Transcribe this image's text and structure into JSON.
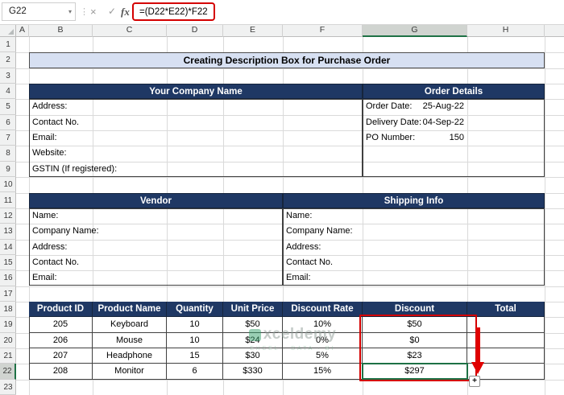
{
  "formula_bar": {
    "name_box": "G22",
    "formula": "=(D22*E22)*F22",
    "fx_label": "fx"
  },
  "icons": {
    "cancel": "×",
    "enter": "✓",
    "name_box_chevron": "▾",
    "splitter": "⋮",
    "fill_handle": "+"
  },
  "grid": {
    "column_headers": [
      "A",
      "B",
      "C",
      "D",
      "E",
      "F",
      "G",
      "H"
    ],
    "selected_column": "G",
    "row_headers": [
      "1",
      "2",
      "3",
      "4",
      "5",
      "6",
      "7",
      "8",
      "9",
      "10",
      "11",
      "12",
      "13",
      "14",
      "15",
      "16",
      "17",
      "18",
      "19",
      "20",
      "21",
      "22",
      "23"
    ],
    "selected_row": "22",
    "active_cell": "G22"
  },
  "title": "Creating Description Box for Purchase Order",
  "company": {
    "header": "Your Company Name",
    "fields": [
      "Address:",
      "Contact No.",
      "Email:",
      "Website:",
      "GSTIN (If registered):"
    ]
  },
  "order_details": {
    "header": "Order Details",
    "rows": [
      {
        "label": "Order Date:",
        "value": "25-Aug-22"
      },
      {
        "label": "Delivery Date:",
        "value": "04-Sep-22"
      },
      {
        "label": "PO Number:",
        "value": "150"
      }
    ]
  },
  "vendor": {
    "header": "Vendor",
    "fields": [
      "Name:",
      "Company Name:",
      "Address:",
      "Contact No.",
      "Email:"
    ]
  },
  "shipping": {
    "header": "Shipping Info",
    "fields": [
      "Name:",
      "Company Name:",
      "Address:",
      "Contact No.",
      "Email:"
    ]
  },
  "products": {
    "headers": [
      "Product ID",
      "Product Name",
      "Quantity",
      "Unit Price",
      "Discount Rate",
      "Discount",
      "Total"
    ],
    "rows": [
      [
        "205",
        "Keyboard",
        "10",
        "$50",
        "10%",
        "$50",
        ""
      ],
      [
        "206",
        "Mouse",
        "10",
        "$24",
        "0%",
        "$0",
        ""
      ],
      [
        "207",
        "Headphone",
        "15",
        "$30",
        "5%",
        "$23",
        ""
      ],
      [
        "208",
        "Monitor",
        "6",
        "$330",
        "15%",
        "$297",
        ""
      ]
    ]
  },
  "watermark": {
    "brand": "xceldemy",
    "tagline": "EXCEL · DATA · BI"
  },
  "colors": {
    "section_header": "#1F3864",
    "title_bg": "#D7E0F2",
    "annotation_red": "#D40000",
    "selection_green": "#1E7145"
  }
}
